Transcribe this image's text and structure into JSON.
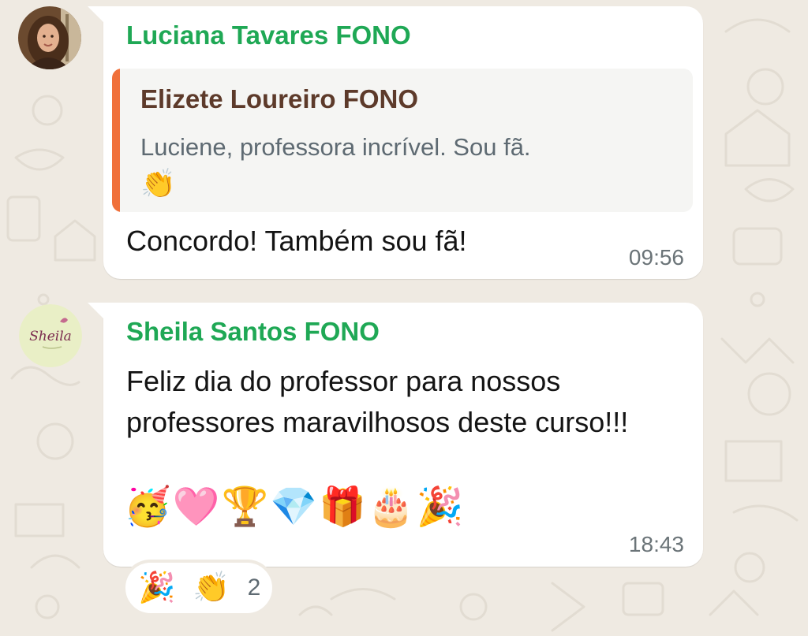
{
  "messages": [
    {
      "sender": "Luciana Tavares FONO",
      "sender_color": "#1fa855",
      "quoted": {
        "author": "Elizete Loureiro FONO",
        "author_color": "#5d3a2a",
        "text": "Luciene, professora incrível. Sou fã.",
        "emoji": "👏",
        "bar_color": "#f0703a"
      },
      "text": "Concordo! Também sou fã!",
      "time": "09:56"
    },
    {
      "sender": "Sheila Santos FONO",
      "sender_color": "#1fa855",
      "avatar_text": "Sheila",
      "text": "Feliz dia do professor para nossos professores maravilhosos deste curso!!!",
      "emojis": "🥳🩷🏆💎🎁🎂🎉",
      "time": "18:43",
      "reactions": {
        "emojis": [
          "🎉",
          "👏"
        ],
        "count": "2"
      }
    }
  ],
  "icons": [
    "profile-photo-luciana",
    "logo-sheila",
    "doodle-wallpaper"
  ],
  "colors": {
    "chat_background": "#efeae2",
    "bubble": "#ffffff",
    "quote_background": "#f5f5f3",
    "timestamp": "#6b7478"
  }
}
